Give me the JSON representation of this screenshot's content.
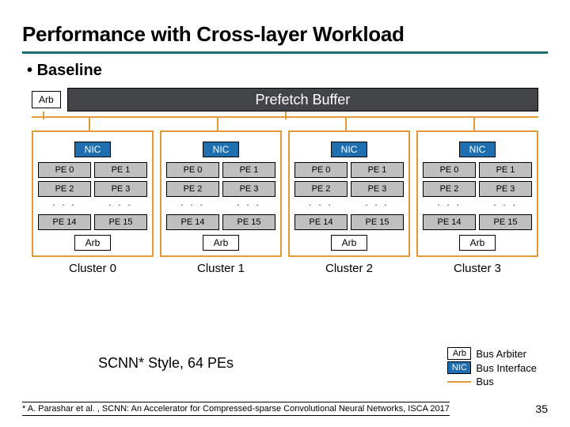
{
  "title": "Performance with Cross-layer Workload",
  "bullet": "Baseline",
  "top": {
    "arb": "Arb",
    "prefetch": "Prefetch Buffer"
  },
  "cluster_template": {
    "nic": "NIC",
    "pes_top": [
      "PE 0",
      "PE 1",
      "PE 2",
      "PE 3"
    ],
    "dots": ". . .",
    "pes_bot": [
      "PE 14",
      "PE 15"
    ],
    "arb": "Arb"
  },
  "cluster_labels": [
    "Cluster 0",
    "Cluster 1",
    "Cluster 2",
    "Cluster 3"
  ],
  "legend_left": "SCNN* Style, 64 PEs",
  "legend": {
    "arb_box": "Arb",
    "arb_label": "Bus Arbiter",
    "nic_box": "NIC",
    "nic_label": "Bus Interface",
    "bus_label": "Bus"
  },
  "footnote": "* A. Parashar et al. , SCNN: An Accelerator for Compressed-sparse Convolutional Neural Networks, ISCA 2017",
  "page": "35"
}
